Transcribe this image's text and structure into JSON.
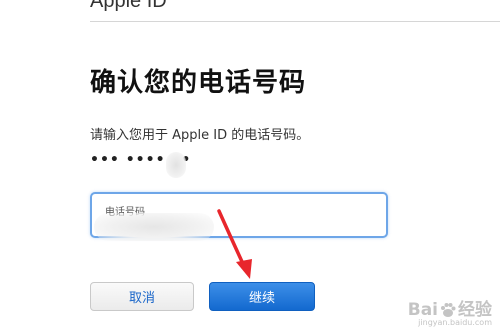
{
  "header": {
    "title": "Apple ID"
  },
  "page": {
    "title": "确认您的电话号码",
    "instruction": "请输入您用于 Apple ID 的电话号码。",
    "masked_number": "••• •••• ••"
  },
  "form": {
    "phone_field_label": "电话号码",
    "phone_field_value": ""
  },
  "buttons": {
    "cancel_label": "取消",
    "continue_label": "继续"
  },
  "annotation": {
    "arrow_color": "#e8262c"
  },
  "colors": {
    "accent_blue": "#1369cf",
    "field_border": "#6ea6e8",
    "link_blue": "#1a66c9"
  },
  "watermark": {
    "brand_left": "Bai",
    "brand_right": "经验",
    "url": "jingyan.baidu.com",
    "paw_icon": "baidu-paw-icon"
  }
}
